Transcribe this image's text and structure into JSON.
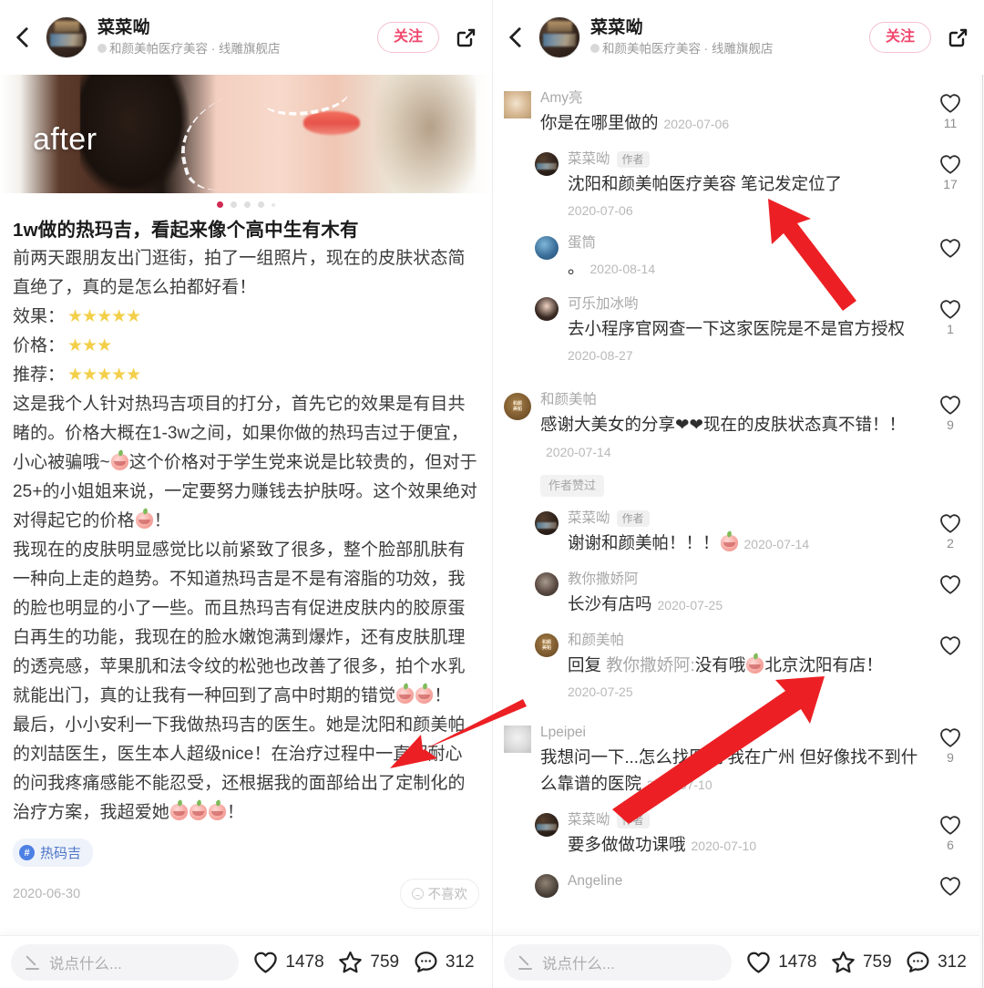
{
  "header": {
    "back_icon": "chevron-left-icon",
    "avatar": "user-avatar",
    "name": "菜菜呦",
    "subtitle": "和颜美帕医疗美容 · 线雕旗舰店",
    "follow_label": "关注",
    "share_icon": "share-external-icon"
  },
  "photo": {
    "overlay_label": "after",
    "dots_total": 5,
    "dots_active": 1
  },
  "note": {
    "title": "1w做的热玛吉，看起来像个高中生有木有",
    "paragraph1": "前两天跟朋友出门逛街，拍了一组照片，现在的皮肤状态简直绝了，真的是怎么拍都好看！",
    "ratings": [
      {
        "label": "效果：",
        "stars": "★★★★★",
        "count": 5
      },
      {
        "label": "价格：",
        "stars": "★★★",
        "count": 3
      },
      {
        "label": "推荐：",
        "stars": "★★★★★",
        "count": 5
      }
    ],
    "paragraph2a": "这是我个人针对热玛吉项目的打分，首先它的效果是有目共睹的。价格大概在1-3w之间，如果你做的热玛吉过于便宜，小心被骗哦~",
    "paragraph2b": "这个价格对于学生党来说是比较贵的，但对于25+的小姐姐来说，一定要努力赚钱去护肤呀。这个效果绝对对得起它的价格",
    "paragraph2c": "！",
    "paragraph3a": "我现在的皮肤明显感觉比以前紧致了很多，整个脸部肌肤有一种向上走的趋势。不知道热玛吉是不是有溶脂的功效，我的脸也明显的小了一些。而且热玛吉有促进皮肤内的胶原蛋白再生的功能，我现在的脸水嫩饱满到爆炸，还有皮肤肌理的透亮感，苹果肌和法令纹的松弛也改善了很多，拍个水乳就能出门，真的让我有一种回到了高中时期的错觉",
    "paragraph3b": "！",
    "paragraph4a": "最后，小小安利一下我做热玛吉的医生。她是沈阳和颜美帕的刘喆医生，医生本人超级nice！在治疗过程中一直超耐心的问我疼痛感能不能忍受，还根据我的面部给出了定制化的治疗方案，我超爱她",
    "paragraph4b": "！",
    "tag": "热码吉",
    "tag_icon": "hash-icon",
    "date": "2020-06-30",
    "dislike_label": "不喜欢",
    "dislike_icon": "sad-face-icon"
  },
  "comments": [
    {
      "avatar": "av-amy",
      "user": "Amy亮",
      "is_author": false,
      "text": "你是在哪里做的",
      "inline_date": "2020-07-06",
      "date": "",
      "likes": "11",
      "reply": false,
      "liked_badge": ""
    },
    {
      "avatar": "av-author",
      "user": "菜菜呦",
      "is_author": true,
      "author_label": "作者",
      "text": "沈阳和颜美帕医疗美容 笔记发定位了",
      "inline_date": "",
      "date": "2020-07-06",
      "likes": "17",
      "reply": true,
      "liked_badge": ""
    },
    {
      "avatar": "av-dan",
      "user": "蛋筒",
      "is_author": false,
      "text": "。",
      "inline_date": "2020-08-14",
      "date": "",
      "likes": "",
      "reply": true,
      "liked_badge": ""
    },
    {
      "avatar": "av-cola",
      "user": "可乐加冰哟",
      "is_author": false,
      "text": "去小程序官网查一下这家医院是不是官方授权",
      "inline_date": "",
      "date": "2020-08-27",
      "likes": "1",
      "reply": true,
      "liked_badge": ""
    },
    {
      "avatar": "av-brand",
      "user": "和颜美帕",
      "is_author": false,
      "text": "感谢大美女的分享❤❤现在的皮肤状态真不错！！",
      "inline_date": "2020-07-14",
      "date": "",
      "likes": "9",
      "reply": false,
      "liked_badge": "作者赞过"
    },
    {
      "avatar": "av-author",
      "user": "菜菜呦",
      "is_author": true,
      "author_label": "作者",
      "text": "谢谢和颜美帕！！！",
      "inline_date": "2020-07-14",
      "date": "",
      "likes": "2",
      "reply": true,
      "liked_badge": ""
    },
    {
      "avatar": "av-jiao",
      "user": "教你撒娇阿",
      "is_author": false,
      "text": "长沙有店吗",
      "inline_date": "2020-07-25",
      "date": "",
      "likes": "",
      "reply": true,
      "liked_badge": ""
    },
    {
      "avatar": "av-brand",
      "user": "和颜美帕",
      "is_author": false,
      "reply_prefix": "回复",
      "reply_target": "教你撒娇阿:",
      "text": "没有哦",
      "text_tail": "北京沈阳有店！",
      "inline_date": "",
      "date": "2020-07-25",
      "likes": "",
      "reply": true,
      "liked_badge": ""
    },
    {
      "avatar": "av-lpei",
      "user": "Lpeipei",
      "is_author": false,
      "text": "我想问一下...怎么找医院 我在广州 但好像找不到什么靠谱的医院",
      "inline_date": "2020-07-10",
      "date": "",
      "likes": "9",
      "reply": false,
      "liked_badge": ""
    },
    {
      "avatar": "av-author",
      "user": "菜菜呦",
      "is_author": true,
      "author_label": "作者",
      "text": "要多做做功课哦",
      "inline_date": "2020-07-10",
      "date": "",
      "likes": "6",
      "reply": true,
      "liked_badge": ""
    },
    {
      "avatar": "av-ang",
      "user": "Angeline",
      "is_author": false,
      "text": "",
      "inline_date": "",
      "date": "",
      "likes": "",
      "reply": true,
      "liked_badge": ""
    }
  ],
  "bottombar": {
    "placeholder": "说点什么...",
    "pen_icon": "pencil-icon",
    "like_icon": "heart-icon",
    "like_count": "1478",
    "collect_icon": "star-icon",
    "collect_count": "759",
    "comment_icon": "comment-bubble-icon",
    "comment_count": "312"
  },
  "colors": {
    "accent_pink": "#f0486e",
    "tag_blue": "#4d76c8",
    "arrow_red": "#ec2024",
    "dot_active": "#d02a52",
    "edge_green": "#86d14a"
  },
  "annotations": [
    {
      "name": "arrow-to-author-reply",
      "color": "#ec2024"
    },
    {
      "name": "arrow-to-doctor-text",
      "color": "#ec2024"
    },
    {
      "name": "arrow-to-beijing-shenyang",
      "color": "#ec2024"
    }
  ]
}
